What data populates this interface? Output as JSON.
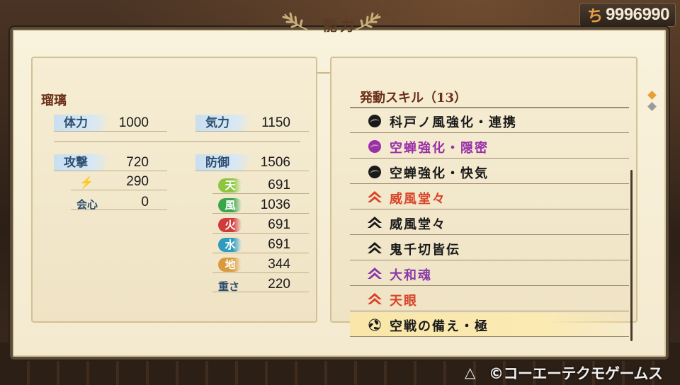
{
  "gold": {
    "value": "9996990",
    "icon": "coin-icon"
  },
  "screen": {
    "title": "能力"
  },
  "character": {
    "name": "瑠璃"
  },
  "stats": {
    "hp_label": "体力",
    "hp": "1000",
    "ki_label": "気力",
    "ki": "1150",
    "attack_label": "攻撃",
    "attack": "720",
    "defense_label": "防御",
    "defense": "1506",
    "bolt_value": "290",
    "crit_label": "会心",
    "crit": "0",
    "weight_label": "重さ",
    "weight": "220"
  },
  "elements": [
    {
      "label": "天",
      "value": "691",
      "color": "#8cc63e"
    },
    {
      "label": "風",
      "value": "1036",
      "color": "#3aa64a"
    },
    {
      "label": "火",
      "value": "691",
      "color": "#cf3b3b"
    },
    {
      "label": "水",
      "value": "691",
      "color": "#2e9bbf"
    },
    {
      "label": "地",
      "value": "344",
      "color": "#d89a3a"
    }
  ],
  "skills": {
    "header": "発動スキル（13）",
    "items": [
      {
        "text": "科戸ノ風強化・連携",
        "color": "#1a1a1a",
        "icon": "magatama-dark-icon"
      },
      {
        "text": "空蝉強化・隠密",
        "color": "#9a2fa8",
        "icon": "magatama-purple-icon"
      },
      {
        "text": "空蝉強化・快気",
        "color": "#1a1a1a",
        "icon": "magatama-dark-icon"
      },
      {
        "text": "威風堂々",
        "color": "#d8442a",
        "icon": "chevron-red-icon"
      },
      {
        "text": "威風堂々",
        "color": "#1a1a1a",
        "icon": "chevron-dark-icon"
      },
      {
        "text": "鬼千切皆伝",
        "color": "#1a1a1a",
        "icon": "chevron-dark-icon"
      },
      {
        "text": "大和魂",
        "color": "#8a3aa8",
        "icon": "chevron-purple-icon"
      },
      {
        "text": "天眼",
        "color": "#d8442a",
        "icon": "chevron-red-icon"
      },
      {
        "text": "空戦の備え・極",
        "color": "#1a1a1a",
        "icon": "triple-tomoe-icon"
      }
    ]
  },
  "footer": {
    "button": "△",
    "copyright": "©コーエーテクモゲームス"
  }
}
